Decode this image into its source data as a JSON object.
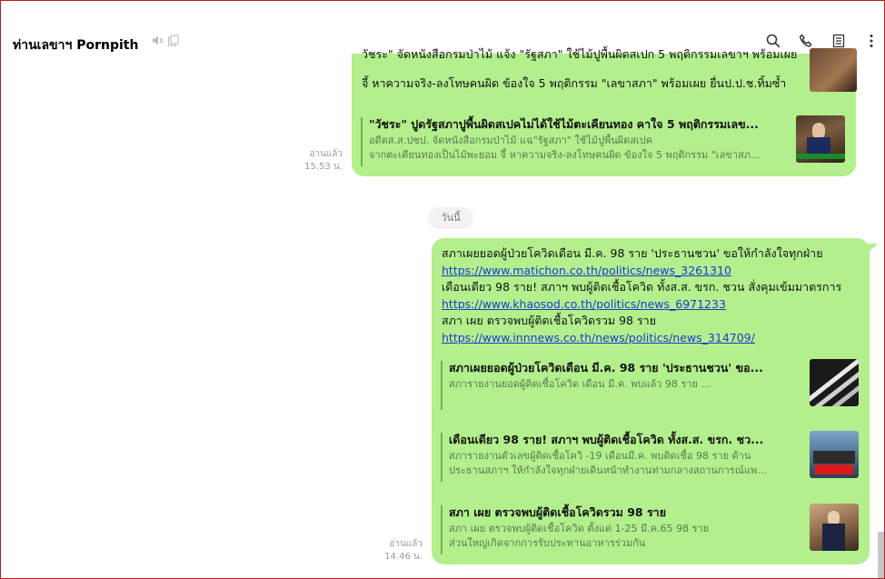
{
  "header": {
    "title": "ท่านเลขาฯ Pornpith",
    "icons": [
      "mute-icon",
      "note-icon"
    ],
    "actions": [
      "search-icon",
      "call-icon",
      "notes-icon",
      "more-icon"
    ]
  },
  "old_message": {
    "partial_line_1": "วัชระ\" จัดหนังสือกรมป่าไม้ แจ้ง \"รัฐสภา\" ใช้ไม้ปูพื้นผิดสเปก 5 พฤติกรรมเลขาฯ พร้อมเผย",
    "partial_line_2": "จี้ หาความจริง-ลงโทษคนผิด ข้องใจ 5 พฤติกรรม \"เลขาสภา\" พร้อมเผย ยื่นป.ป.ช.ทิ้มซ้ำ",
    "preview": {
      "title": "\"วัชระ\" ปูดรัฐสภาปูพื้นผิดสเปคไม่ได้ใช้ไม้ตะเคียนทอง คาใจ 5 พฤติกรรมเลข...",
      "desc_1": "อดีตส.ส.ปชป. จัดหนังสือกรมป่าไม้ แฉ\"รัฐสภา\" ใช้ไม้ปูพื้นผิดสเปค",
      "desc_2": "จากตะเคียนทองเป็นไม้พะยอม จี้ หาความจริง-ลงโทษคนผิด ข้องใจ 5 พฤติกรรม \"เลขาสภ..."
    },
    "read_label": "อ่านแล้ว",
    "time": "15.53 น."
  },
  "date_separator": "วันนี้",
  "new_message": {
    "line_1": "สภาเผยยอดผู้ป่วยโควิดเดือน มี.ค. 98 ราย 'ประธานชวน' ขอให้กำลังใจทุกฝ่าย",
    "link_1": "https://www.matichon.co.th/politics/news_3261310",
    "line_2": "เดือนเดียว 98 ราย! สภาฯ พบผู้ติดเชื้อโควิด ทั้งส.ส. ขรก. ชวน สั่งคุมเข้มมาตรการ",
    "link_2": "https://www.khaosod.co.th/politics/news_6971233",
    "line_3": "สภา เผย ตรวจพบผู้ติดเชื้อโควิดรวม 98 ราย",
    "link_3": "https://www.innnews.co.th/news/politics/news_314709/",
    "previews": [
      {
        "title": "สภาเผยยอดผู้ป่วยโควิดเดือน มี.ค. 98 ราย 'ประธานชวน' ขอ...",
        "desc_1": "สภารายงานยอดผู้ติดเชื้อโควิด เดือน มี.ค. พบแล้ว 98 ราย ...",
        "desc_2": ""
      },
      {
        "title": "เดือนเดียว 98 ราย! สภาฯ พบผู้ติดเชื้อโควิด ทั้งส.ส. ขรก. ชว...",
        "desc_1": "สภารายงานตัวเลขผู้ติดเชื้อโควิ -19 เดือนมี.ค. พบติดเชื้อ 98 ราย ด้าน",
        "desc_2": "ประธานสภาฯ ให้กำลังใจทุกฝ่ายเดินหน้าทำงานท่ามกลางสถานการณ์แพ..."
      },
      {
        "title": "สภา เผย ตรวจพบผู้ติดเชื้อโควิดรวม 98 ราย",
        "desc_1": "สภา เผย ตรวจพบผู้ติดเชื้อโควิด ตั้งแต่ 1-25 มี.ค.65 98 ราย",
        "desc_2": "ส่วนใหญ่เกิดจากการรับประทานอาหารร่วมกัน"
      }
    ],
    "read_label": "อ่านแล้ว",
    "time": "14.46 น."
  },
  "colors": {
    "bubble": "#b3ef8d",
    "link": "#1a3acf",
    "frame_border": "#b21e24"
  }
}
